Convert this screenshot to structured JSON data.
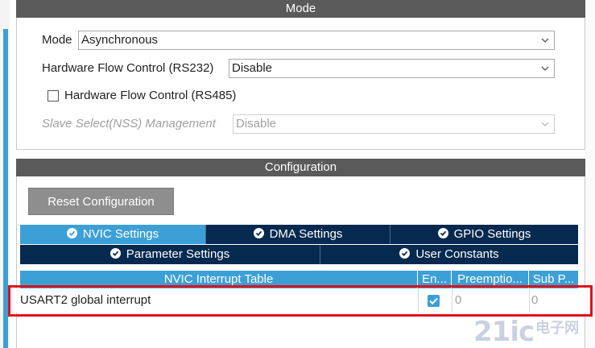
{
  "mode_section": {
    "header": "Mode",
    "mode": {
      "label": "Mode",
      "value": "Asynchronous"
    },
    "hw_flow_rs232": {
      "label": "Hardware Flow Control (RS232)",
      "value": "Disable"
    },
    "hw_flow_rs485": {
      "label": "Hardware Flow Control (RS485)",
      "checked": false
    },
    "slave_select": {
      "label": "Slave Select(NSS) Management",
      "value": "Disable",
      "disabled": true
    }
  },
  "configuration": {
    "header": "Configuration",
    "reset_button": "Reset Configuration",
    "tabs_row1": [
      {
        "label": "NVIC Settings",
        "active": true
      },
      {
        "label": "DMA Settings",
        "active": false
      },
      {
        "label": "GPIO Settings",
        "active": false
      }
    ],
    "tabs_row2": [
      {
        "label": "Parameter Settings",
        "active": false
      },
      {
        "label": "User Constants",
        "active": false
      }
    ],
    "table": {
      "columns": [
        "NVIC Interrupt Table",
        "En...",
        "Preemptio...",
        "Sub P..."
      ],
      "rows": [
        {
          "name": "USART2 global interrupt",
          "enabled": true,
          "preemption": "0",
          "sub_priority": "0"
        }
      ]
    }
  },
  "watermark": {
    "big": "21ic",
    "small": "电子网"
  },
  "colors": {
    "header_bg": "#5a5a5a",
    "tab_bg": "#06294f",
    "tab_active": "#3ca0d6",
    "highlight": "#e0121a"
  }
}
